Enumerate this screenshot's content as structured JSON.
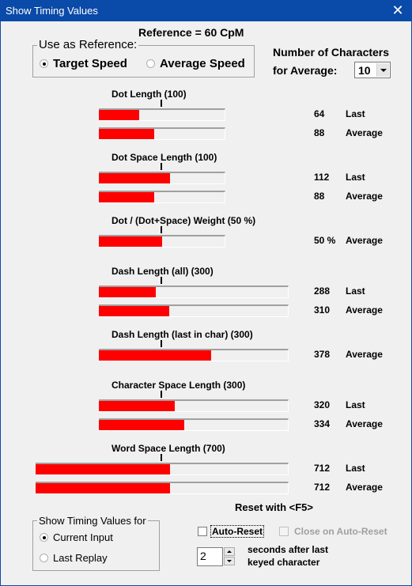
{
  "window": {
    "title": "Show Timing Values",
    "close_icon": "close-icon"
  },
  "reference_text": "Reference = 60 CpM",
  "reference_group": {
    "legend": "Use as Reference:",
    "options": [
      {
        "label": "Target Speed",
        "selected": true
      },
      {
        "label": "Average Speed",
        "selected": false
      }
    ]
  },
  "average": {
    "label_line1": "Number of Characters",
    "label_line2": "for Average:",
    "selected": "10"
  },
  "measurements": [
    {
      "title": "Dot Length (100)",
      "rows": [
        {
          "value": "64",
          "kind": "Last",
          "fill": 0.32
        },
        {
          "value": "88",
          "kind": "Average",
          "fill": 0.44
        }
      ]
    },
    {
      "title": "Dot Space Length (100)",
      "rows": [
        {
          "value": "112",
          "kind": "Last",
          "fill": 0.56
        },
        {
          "value": "88",
          "kind": "Average",
          "fill": 0.44
        }
      ]
    },
    {
      "title": "Dot / (Dot+Space) Weight (50 %)",
      "rows": [
        {
          "value": "50 %",
          "kind": "Average",
          "fill": 0.5
        }
      ]
    },
    {
      "title": "Dash Length (all) (300)",
      "rows": [
        {
          "value": "288",
          "kind": "Last",
          "fill": 0.3
        },
        {
          "value": "310",
          "kind": "Average",
          "fill": 0.37
        }
      ]
    },
    {
      "title": "Dash Length (last in char) (300)",
      "rows": [
        {
          "value": "378",
          "kind": "Average",
          "fill": 0.59
        }
      ]
    },
    {
      "title": "Character Space Length (300)",
      "rows": [
        {
          "value": "320",
          "kind": "Last",
          "fill": 0.4
        },
        {
          "value": "334",
          "kind": "Average",
          "fill": 0.45
        }
      ]
    },
    {
      "title": "Word Space Length (700)",
      "rows": [
        {
          "value": "712",
          "kind": "Last",
          "fill": 0.53
        },
        {
          "value": "712",
          "kind": "Average",
          "fill": 0.53
        }
      ]
    }
  ],
  "show_for_group": {
    "legend": "Show Timing Values for",
    "options": [
      {
        "label": "Current Input",
        "selected": true
      },
      {
        "label": "Last Replay",
        "selected": false
      }
    ]
  },
  "reset": {
    "label": "Reset with <F5>",
    "auto_reset_label": "Auto-Reset",
    "auto_reset_checked": false,
    "close_on_auto_reset_label": "Close on Auto-Reset",
    "close_on_auto_reset_checked": false,
    "seconds_value": "2",
    "seconds_label_line1": "seconds after last",
    "seconds_label_line2": "keyed character"
  },
  "colors": {
    "title_bar": "#0a4aa8",
    "bar_fill": "#ff0000",
    "background": "#f0f0f0"
  }
}
